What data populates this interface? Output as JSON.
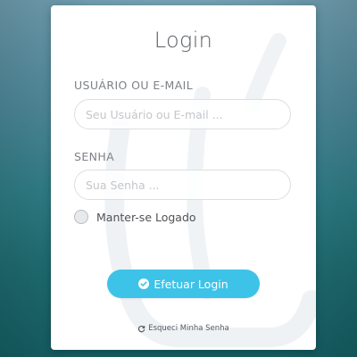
{
  "login": {
    "title": "Login",
    "user_label": "USUÁRIO OU E-MAIL",
    "user_placeholder": "Seu Usuário ou E-mail ...",
    "user_value": "",
    "password_label": "SENHA",
    "password_placeholder": "Sua Senha ...",
    "password_value": "",
    "remember_label": "Manter-se Logado",
    "remember_checked": false,
    "submit_label": "Efetuar Login",
    "forgot_label": "Esqueci Minha Senha"
  },
  "icons": {
    "submit": "check-circle-icon",
    "forgot": "refresh-icon"
  },
  "colors": {
    "accent": "#3dc3e8",
    "card": "#ffffff",
    "text": "#5e6166"
  }
}
